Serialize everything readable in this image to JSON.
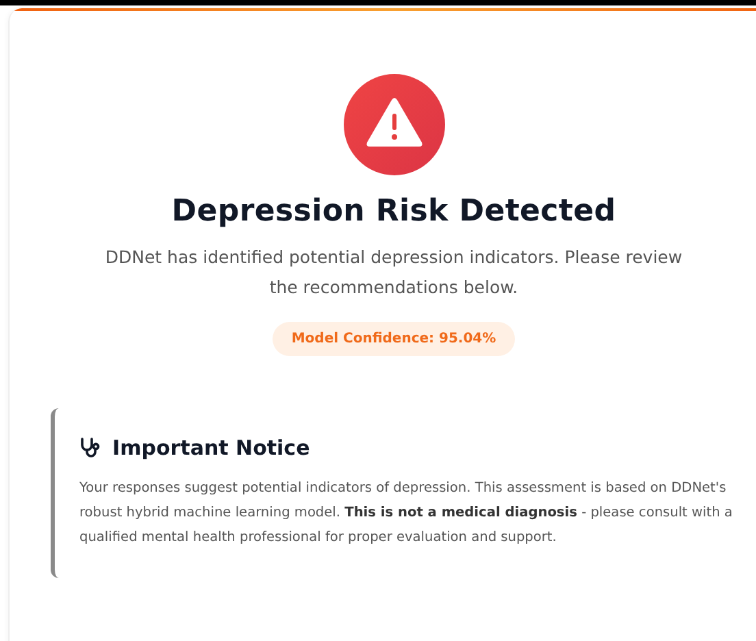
{
  "result": {
    "title": "Depression Risk Detected",
    "description": "DDNet has identified potential depression indicators. Please review the recommendations below.",
    "confidence": "Model Confidence: 95.04%"
  },
  "notice": {
    "title": "Important Notice",
    "body": "Your responses suggest potential indicators of depression. This assessment is based on DDNet's robust hybrid machine learning model. **This is not a medical diagnosis** - please consult with a qualified mental health professional for proper evaluation and support."
  }
}
